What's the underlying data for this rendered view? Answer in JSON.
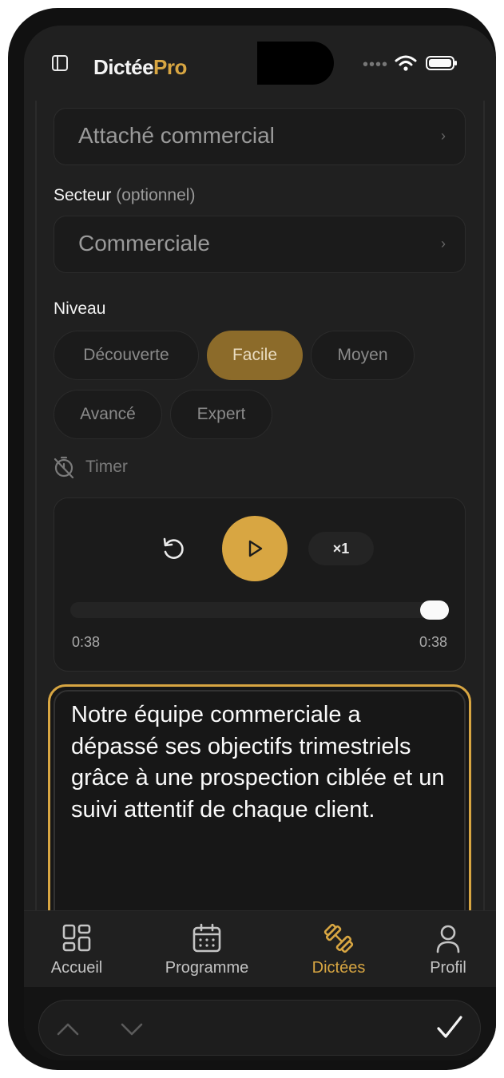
{
  "app": {
    "brand_main": "Dictée",
    "brand_accent": "Pro"
  },
  "status_bar": {
    "signal_dots": "••••"
  },
  "form": {
    "poste_value": "Attaché commercial",
    "secteur_label": "Secteur",
    "secteur_optional": "(optionnel)",
    "secteur_value": "Commerciale",
    "niveau_label": "Niveau",
    "niveaux": [
      "Découverte",
      "Facile",
      "Moyen",
      "Avancé",
      "Expert"
    ],
    "niveau_selected": "Facile",
    "timer_label": "Timer"
  },
  "player": {
    "speed": "×1",
    "elapsed": "0:38",
    "duration": "0:38",
    "progress": 1.0
  },
  "dictation_text": "Notre équipe commerciale a dépassé ses objectifs trimestriels grâce à une prospection ciblée et un suivi attentif de chaque client.",
  "tabs": [
    {
      "label": "Accueil",
      "icon": "grid-icon"
    },
    {
      "label": "Programme",
      "icon": "calendar-icon"
    },
    {
      "label": "Dictées",
      "icon": "dumbbell-icon",
      "active": true
    },
    {
      "label": "Profil",
      "icon": "user-icon"
    }
  ],
  "colors": {
    "accent": "#d8a642",
    "background": "#202020",
    "card": "#1b1b1b"
  }
}
